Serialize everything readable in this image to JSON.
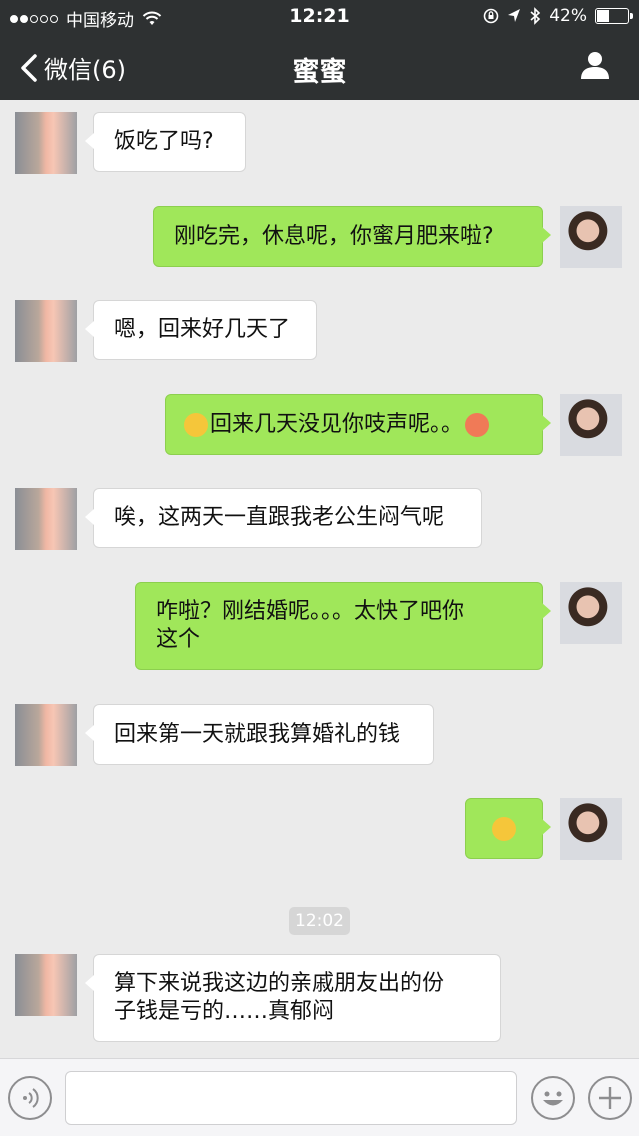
{
  "status_bar": {
    "carrier": "中国移动",
    "time": "12:21",
    "battery_percent": "42%",
    "battery_level": 0.42
  },
  "nav": {
    "back_label": "微信(6)",
    "title": "蜜蜜"
  },
  "messages": [
    {
      "side": "in",
      "text": "饭吃了吗?"
    },
    {
      "side": "out",
      "text": "刚吃完，休息呢，你蜜月肥来啦?"
    },
    {
      "side": "in",
      "text": "嗯，回来好几天了"
    },
    {
      "side": "out",
      "text": "回来几天没见你吱声呢。。",
      "emoji_before": "unamused-face-emoji",
      "emoji_after": "angry-face-emoji"
    },
    {
      "side": "in",
      "text": "唉，这两天一直跟我老公生闷气呢"
    },
    {
      "side": "out",
      "text_line1": "咋啦？刚结婚呢。。。太快了吧你",
      "text_line2": "这个"
    },
    {
      "side": "in",
      "text": "回来第一天就跟我算婚礼的钱"
    },
    {
      "side": "out",
      "emoji_only": "surprised-face-emoji"
    },
    {
      "side": "in",
      "text_line1": "算下来说我这边的亲戚朋友出的份",
      "text_line2": "子钱是亏的……真郁闷"
    }
  ],
  "timestamp": "12:02",
  "colors": {
    "header_bg": "#2e3132",
    "chat_bg": "#ebebeb",
    "outgoing_bubble": "#a0e75a",
    "incoming_bubble": "#ffffff"
  }
}
